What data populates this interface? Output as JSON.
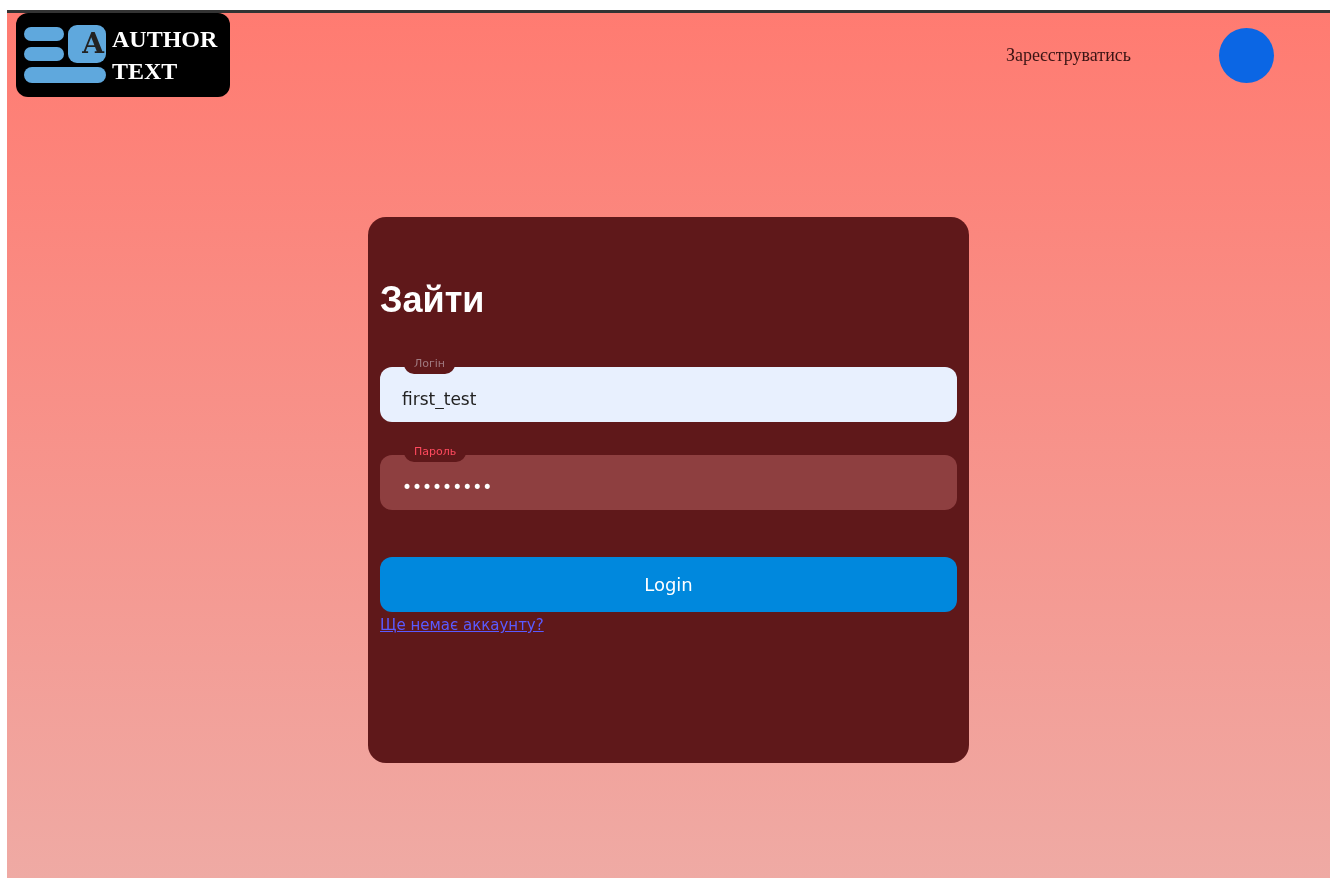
{
  "header": {
    "logo": {
      "line_1": "AUTHOR",
      "line_2": "TEXT",
      "letter": "A"
    },
    "register_link": "Зареєструватись"
  },
  "login_card": {
    "title": "Зайти",
    "fields": [
      {
        "label": "Логін",
        "value": "first_test",
        "highlighted": true
      },
      {
        "label": "Пароль",
        "value": "•••••••••",
        "highlighted": false
      }
    ],
    "submit_button": "Login",
    "signup_link": "Ще немає аккаунту?"
  }
}
